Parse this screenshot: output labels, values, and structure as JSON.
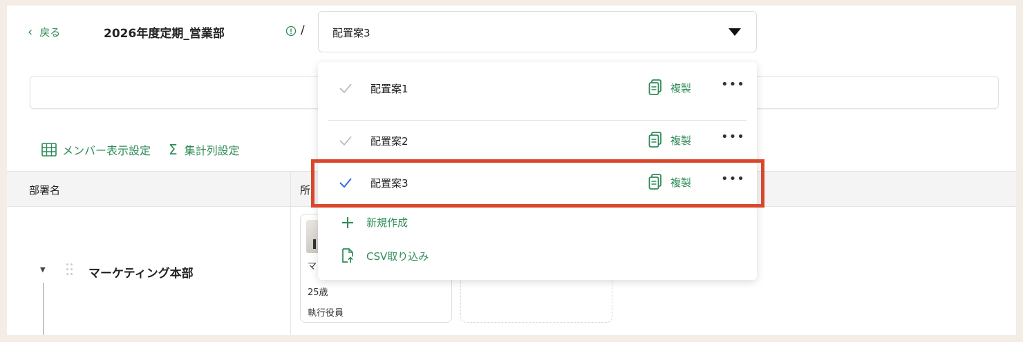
{
  "header": {
    "back_label": "戻る",
    "title": "2026年度定期_営業部",
    "separator": "/",
    "selected_plan": "配置案3"
  },
  "toolbar": {
    "member_settings": "メンバー表示設定",
    "aggregate_settings": "集計列設定"
  },
  "table": {
    "columns": [
      "部署名",
      "所"
    ],
    "rows": [
      {
        "department": "マーケティング本部",
        "member": {
          "name": "マ",
          "age": "25歳",
          "role": "執行役員"
        }
      }
    ]
  },
  "menu": {
    "items": [
      {
        "label": "配置案1",
        "copy": "複製",
        "more": "•••",
        "selected": false
      },
      {
        "label": "配置案2",
        "copy": "複製",
        "more": "•••",
        "selected": false
      },
      {
        "label": "配置案3",
        "copy": "複製",
        "more": "•••",
        "selected": true
      }
    ],
    "new_label": "新規作成",
    "csv_label": "CSV取り込み"
  },
  "colors": {
    "accent": "#2e8b57",
    "selected_check": "#2f6fe0",
    "unselected_check": "#b5b5b5",
    "highlight": "#d9472b"
  }
}
